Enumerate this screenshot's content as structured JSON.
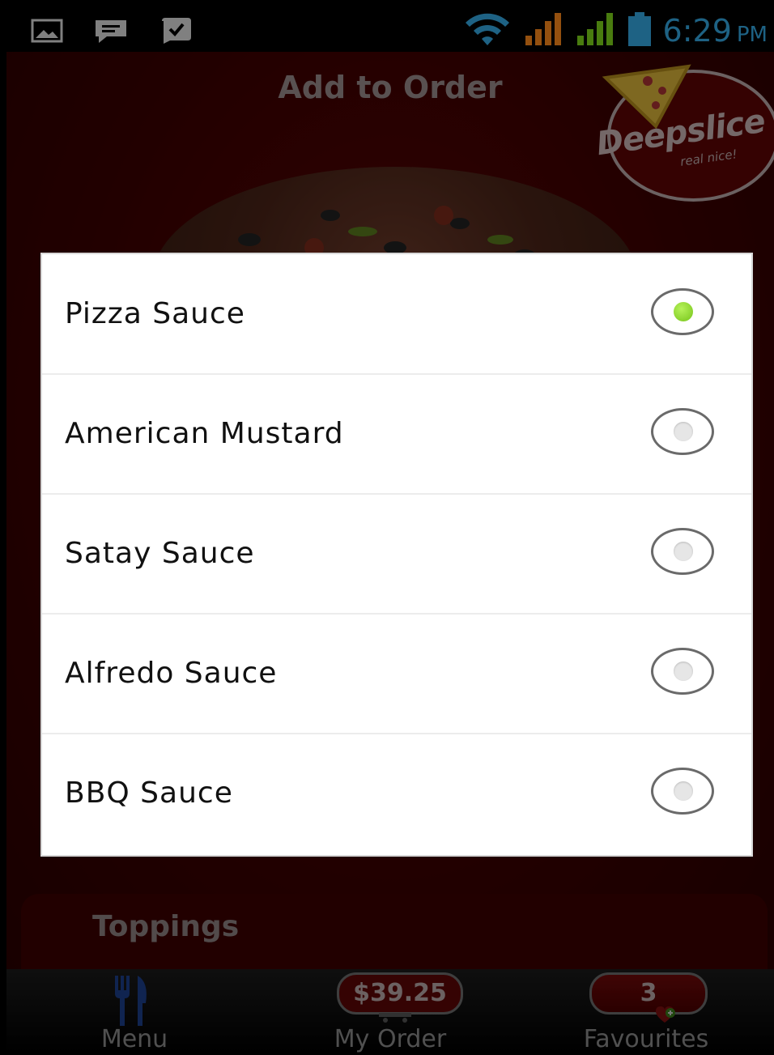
{
  "status_bar": {
    "time": "6:29",
    "ampm": "PM",
    "left_icons": [
      "image-icon",
      "chat-icon",
      "bbm-icon"
    ],
    "right_icons": [
      "wifi-icon",
      "signal-orange-icon",
      "signal-green-icon",
      "battery-icon"
    ],
    "clock_color": "#35a9e3"
  },
  "screen": {
    "title": "Add to Order",
    "logo": {
      "wordmark": "Deepslice",
      "tagline": "real nice!"
    },
    "toppings_title": "Toppings"
  },
  "dialog": {
    "options": [
      {
        "label": "Pizza Sauce",
        "selected": true
      },
      {
        "label": "American Mustard",
        "selected": false
      },
      {
        "label": "Satay Sauce",
        "selected": false
      },
      {
        "label": "Alfredo Sauce",
        "selected": false
      },
      {
        "label": "BBQ Sauce",
        "selected": false
      }
    ],
    "selected_color": "#8fd82e"
  },
  "bottom_nav": {
    "menu_label": "Menu",
    "order_label": "My Order",
    "order_total": "$39.25",
    "favourites_label": "Favourites",
    "favourites_count": "3"
  }
}
